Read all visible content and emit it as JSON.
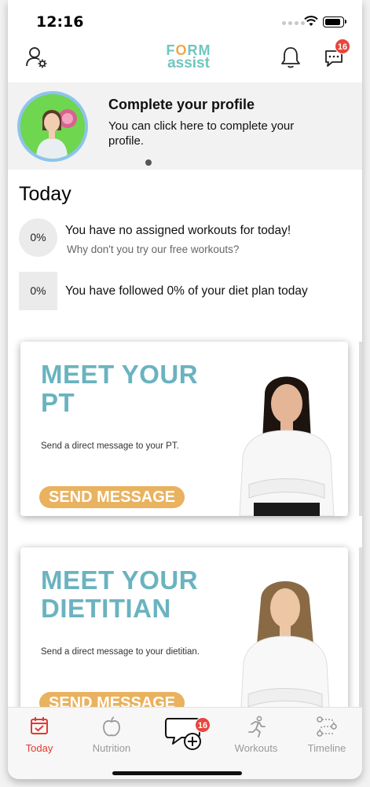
{
  "status_bar": {
    "time": "12:16"
  },
  "header": {
    "logo_line1_a": "F",
    "logo_line1_o": "O",
    "logo_line1_b": "RM",
    "logo_line2": "assist",
    "messages_badge": "16",
    "icons": [
      "profile-settings-icon",
      "bell-icon",
      "chat-icon"
    ]
  },
  "profile_banner": {
    "title": "Complete your profile",
    "description": "You can click here to complete your profile."
  },
  "today": {
    "title": "Today",
    "workout_pct": "0%",
    "workout_text": "You have no assigned workouts for today!",
    "workout_hint": "Why don't you try our free workouts?",
    "diet_pct": "0%",
    "diet_text": "You have followed 0% of your diet plan today"
  },
  "cards": [
    {
      "heading": "MEET YOUR PT",
      "subtitle": "Send a direct message to your PT.",
      "cta": "SEND MESSAGE"
    },
    {
      "heading": "MEET YOUR DIETITIAN",
      "subtitle": "Send a direct message to your dietitian.",
      "cta": "SEND MESSAGE"
    }
  ],
  "tabbar": {
    "tabs": [
      {
        "label": "Today",
        "icon": "calendar-check-icon",
        "active": true
      },
      {
        "label": "Nutrition",
        "icon": "apple-icon",
        "active": false
      },
      {
        "label": "",
        "icon": "chat-add-icon",
        "active": false
      },
      {
        "label": "Workouts",
        "icon": "runner-icon",
        "active": false
      },
      {
        "label": "Timeline",
        "icon": "timeline-icon",
        "active": false
      }
    ],
    "center_badge": "16"
  },
  "colors": {
    "accent_teal": "#6ab3bf",
    "cta_orange": "#e9b25f",
    "active_red": "#e03a32",
    "badge_red": "#e8453c"
  }
}
